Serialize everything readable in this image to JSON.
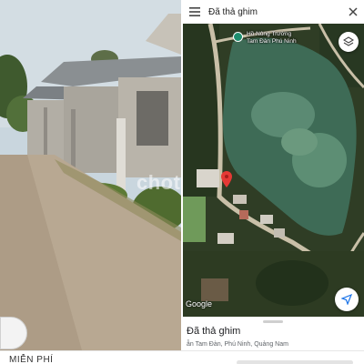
{
  "listing": {
    "watermark": "chot",
    "badge": "MIỄN PHÍ"
  },
  "maps": {
    "topbar_title": "Đã thả ghim",
    "poi_label_line1": "Hồ Nông Trường",
    "poi_label_line2": "Tam Đàn Phú Ninh",
    "google_logo": "Google",
    "sheet_title": "Đã thả ghim",
    "sheet_address": "ẫn Tam Đàn, Phú Ninh, Quảng Nam"
  },
  "icons": {
    "menu": "menu-icon",
    "close": "close-icon",
    "layers": "layers-icon",
    "pin": "map-pin-icon",
    "locate": "navigation-arrow-icon"
  },
  "colors": {
    "map_pin": "#e53935",
    "poi_pin": "#1e8e6e",
    "lake": "#3e6b56"
  }
}
